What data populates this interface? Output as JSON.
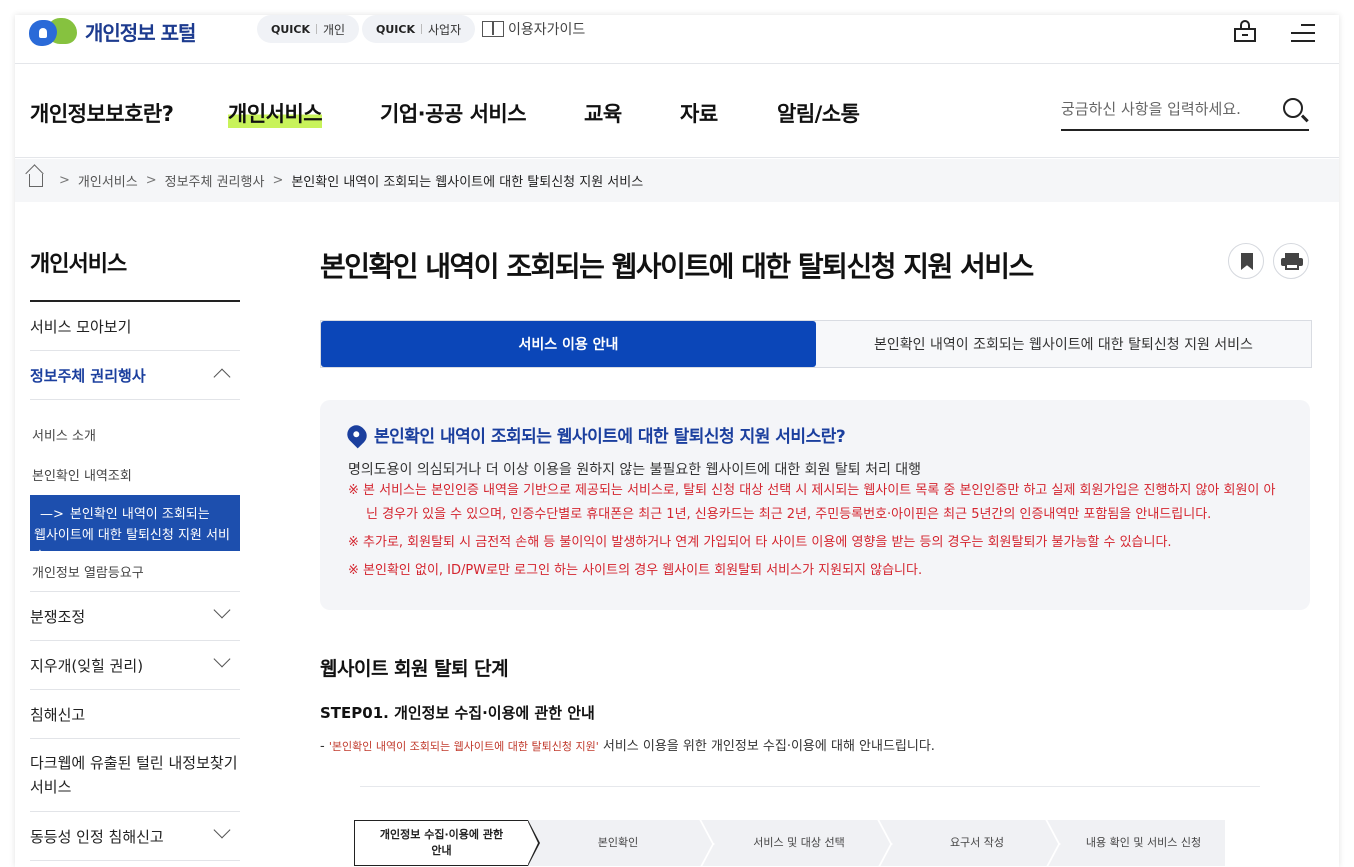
{
  "header": {
    "logo_text": "개인정보 포털",
    "quick_links": [
      {
        "prefix": "QUICK",
        "label": "개인"
      },
      {
        "prefix": "QUICK",
        "label": "사업자"
      }
    ],
    "guide_label": "이용자가이드"
  },
  "gnb": {
    "items": [
      "개인정보보호란?",
      "개인서비스",
      "기업·공공 서비스",
      "교육",
      "자료",
      "알림/소통"
    ],
    "active_index": 1,
    "search_placeholder": "궁금하신 사항을 입력하세요."
  },
  "breadcrumb": [
    "개인서비스",
    "정보주체 권리행사",
    "본인확인 내역이 조회되는 웹사이트에 대한 탈퇴신청 지원 서비스"
  ],
  "sidebar": {
    "title": "개인서비스",
    "items": {
      "collection": "서비스 모아보기",
      "rights": "정보주체 권리행사",
      "sub_intro": "서비스 소개",
      "sub_history": "본인확인 내역조회",
      "sub_active_arrow": "—>",
      "sub_active_line1": "본인확인 내역이 조회되는",
      "sub_active_line2": "웹사이트에 대한 탈퇴신청 지원 서비스",
      "sub_request": "개인정보 열람등요구",
      "dispute": "분쟁조정",
      "eraser": "지우개(잊힐 권리)",
      "report": "침해신고",
      "darkweb_line1": "다크웹에 유출된 털린 내정보찾기",
      "darkweb_line2": "서비스",
      "equality": "동등성 인정 침해신고"
    }
  },
  "main": {
    "title": "본인확인 내역이 조회되는 웹사이트에 대한 탈퇴신청 지원 서비스",
    "tabs": [
      "서비스 이용 안내",
      "본인확인 내역이 조회되는 웹사이트에 대한 탈퇴신청 지원 서비스"
    ],
    "info_heading": "본인확인 내역이 조회되는 웹사이트에 대한 탈퇴신청 지원 서비스란?",
    "info_desc": "명의도용이 의심되거나 더 이상 이용을 원하지 않는 불필요한 웹사이트에 대한 회원 탈퇴 처리 대행",
    "notes": [
      "※ 본 서비스는 본인인증 내역을 기반으로 제공되는 서비스로, 탈퇴 신청 대상 선택 시 제시되는 웹사이트 목록 중 본인인증만 하고 실제 회원가입은 진행하지 않아 회원이 아닌 경우가 있을 수 있으며, 인증수단별로 휴대폰은 최근 1년, 신용카드는 최근 2년, 주민등록번호·아이핀은 최근 5년간의 인증내역만 포함됨을 안내드립니다.",
      "※ 추가로, 회원탈퇴 시 금전적 손해 등 불이익이 발생하거나 연계 가입되어 타 사이트 이용에 영향을 받는 등의 경우는 회원탈퇴가 불가능할 수 있습니다.",
      "※ 본인확인 없이, ID/PW로만 로그인 하는 사이트의 경우 웹사이트 회원탈퇴 서비스가 지원되지 않습니다."
    ],
    "section_heading": "웹사이트 회원 탈퇴 단계",
    "step_heading": "STEP01. 개인정보 수집·이용에 관한 안내",
    "step_desc_prefix": "- ",
    "step_desc_quote": "'본인확인 내역이 조회되는 웹사이트에 대한 탈퇴신청 지원'",
    "step_desc_rest": " 서비스 이용을 위한 개인정보 수집·이용에 대해 안내드립니다.",
    "steps": [
      "개인정보 수집·이용에 관한 안내",
      "본인확인",
      "서비스 및 대상 선택",
      "요구서 작성",
      "내용 확인 및 서비스 신청"
    ]
  },
  "colors": {
    "brand_blue": "#0b46b8",
    "sidebar_active": "#1d4fae",
    "highlight": "#c8f35a",
    "note_red": "#d4252f"
  },
  "icons": [
    "logo-icon",
    "manual-icon",
    "lock-icon",
    "menu-icon",
    "search-icon",
    "home-icon",
    "bookmark-icon",
    "print-icon",
    "pin-icon"
  ]
}
